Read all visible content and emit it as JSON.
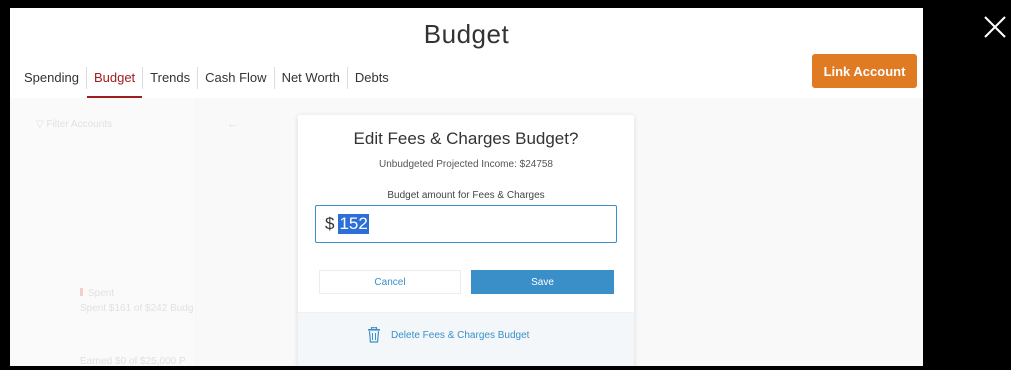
{
  "header": {
    "title": "Budget"
  },
  "tabs": [
    {
      "label": "Spending"
    },
    {
      "label": "Budget",
      "active": true
    },
    {
      "label": "Trends"
    },
    {
      "label": "Cash Flow"
    },
    {
      "label": "Net Worth"
    },
    {
      "label": "Debts"
    }
  ],
  "link_account": "Link Account",
  "background": {
    "filter": "Filter Accounts",
    "spent_label": "Spent",
    "spent_detail": "Spent $161 of $242 Budg",
    "earned_detail": "Earned $0 of $25,000 P"
  },
  "modal": {
    "title": "Edit Fees & Charges Budget?",
    "subtitle": "Unbudgeted Projected Income: $24758",
    "amount_label": "Budget amount for Fees & Charges",
    "currency": "$",
    "amount": "152",
    "cancel": "Cancel",
    "save": "Save",
    "delete": "Delete Fees & Charges Budget"
  },
  "colors": {
    "accent": "#e07a23",
    "active_tab": "#a11d1d",
    "primary": "#3a8fc9"
  }
}
